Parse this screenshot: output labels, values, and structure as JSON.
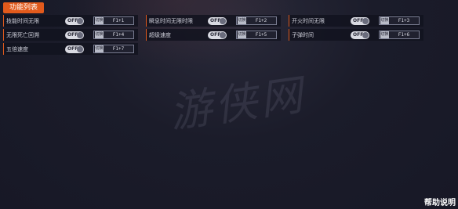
{
  "panel": {
    "title": "功能列表"
  },
  "features": [
    {
      "label": "技能时间无限",
      "toggle": "OFF",
      "switch": "切换",
      "key": "F1+1"
    },
    {
      "label": "瞬息时间无限时限",
      "toggle": "OFF",
      "switch": "切换",
      "key": "F1+2"
    },
    {
      "label": "开火时间无限",
      "toggle": "OFF",
      "switch": "切换",
      "key": "F1+3"
    },
    {
      "label": "无限死亡回溯",
      "toggle": "OFF",
      "switch": "切换",
      "key": "F1+4"
    },
    {
      "label": "超级速度",
      "toggle": "OFF",
      "switch": "切换",
      "key": "F1+5"
    },
    {
      "label": "子弹时间",
      "toggle": "OFF",
      "switch": "切换",
      "key": "F1+6"
    },
    {
      "label": "五倍速度",
      "toggle": "OFF",
      "switch": "切换",
      "key": "F1+7"
    }
  ],
  "watermark": "游侠网",
  "footer": {
    "help": "帮助说明"
  },
  "colors": {
    "accent": "#e25a1c",
    "background": "#1b1c2a"
  }
}
